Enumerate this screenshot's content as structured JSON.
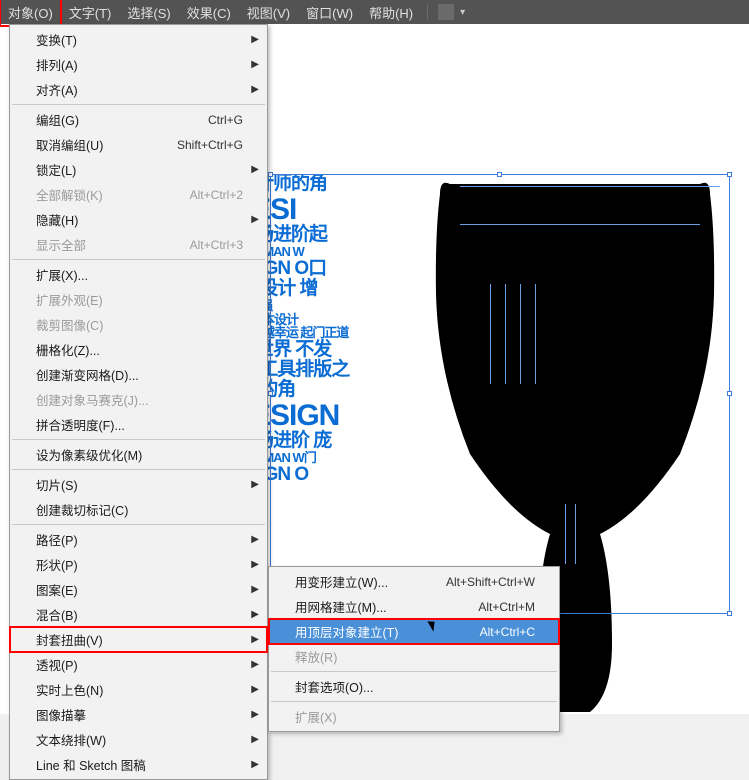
{
  "menubar": {
    "items": [
      {
        "label": "对象(O)",
        "active": true
      },
      {
        "label": "文字(T)"
      },
      {
        "label": "选择(S)"
      },
      {
        "label": "效果(C)"
      },
      {
        "label": "视图(V)"
      },
      {
        "label": "窗口(W)"
      },
      {
        "label": "帮助(H)"
      }
    ]
  },
  "dropdown": [
    {
      "type": "item",
      "label": "变换(T)",
      "submenu": true
    },
    {
      "type": "item",
      "label": "排列(A)",
      "submenu": true
    },
    {
      "type": "item",
      "label": "对齐(A)",
      "submenu": true
    },
    {
      "type": "sep"
    },
    {
      "type": "item",
      "label": "编组(G)",
      "shortcut": "Ctrl+G"
    },
    {
      "type": "item",
      "label": "取消编组(U)",
      "shortcut": "Shift+Ctrl+G"
    },
    {
      "type": "item",
      "label": "锁定(L)",
      "submenu": true
    },
    {
      "type": "item",
      "label": "全部解锁(K)",
      "shortcut": "Alt+Ctrl+2",
      "disabled": true
    },
    {
      "type": "item",
      "label": "隐藏(H)",
      "submenu": true
    },
    {
      "type": "item",
      "label": "显示全部",
      "shortcut": "Alt+Ctrl+3",
      "disabled": true
    },
    {
      "type": "sep"
    },
    {
      "type": "item",
      "label": "扩展(X)..."
    },
    {
      "type": "item",
      "label": "扩展外观(E)",
      "disabled": true
    },
    {
      "type": "item",
      "label": "裁剪图像(C)",
      "disabled": true
    },
    {
      "type": "item",
      "label": "栅格化(Z)..."
    },
    {
      "type": "item",
      "label": "创建渐变网格(D)..."
    },
    {
      "type": "item",
      "label": "创建对象马赛克(J)...",
      "disabled": true
    },
    {
      "type": "item",
      "label": "拼合透明度(F)..."
    },
    {
      "type": "sep"
    },
    {
      "type": "item",
      "label": "设为像素级优化(M)"
    },
    {
      "type": "sep"
    },
    {
      "type": "item",
      "label": "切片(S)",
      "submenu": true
    },
    {
      "type": "item",
      "label": "创建裁切标记(C)"
    },
    {
      "type": "sep"
    },
    {
      "type": "item",
      "label": "路径(P)",
      "submenu": true
    },
    {
      "type": "item",
      "label": "形状(P)",
      "submenu": true
    },
    {
      "type": "item",
      "label": "图案(E)",
      "submenu": true
    },
    {
      "type": "item",
      "label": "混合(B)",
      "submenu": true
    },
    {
      "type": "item",
      "label": "封套扭曲(V)",
      "submenu": true,
      "highlighted": true
    },
    {
      "type": "item",
      "label": "透视(P)",
      "submenu": true
    },
    {
      "type": "item",
      "label": "实时上色(N)",
      "submenu": true
    },
    {
      "type": "item",
      "label": "图像描摹",
      "submenu": true
    },
    {
      "type": "item",
      "label": "文本绕排(W)",
      "submenu": true
    },
    {
      "type": "item",
      "label": "Line 和 Sketch 图稿",
      "submenu": true
    },
    {
      "type": "cutoff"
    }
  ],
  "submenu": [
    {
      "type": "item",
      "label": "用变形建立(W)...",
      "shortcut": "Alt+Shift+Ctrl+W"
    },
    {
      "type": "item",
      "label": "用网格建立(M)...",
      "shortcut": "Alt+Ctrl+M"
    },
    {
      "type": "item",
      "label": "用顶层对象建立(T)",
      "shortcut": "Alt+Ctrl+C",
      "highlighted": true
    },
    {
      "type": "item",
      "label": "释放(R)",
      "disabled": true
    },
    {
      "type": "sep"
    },
    {
      "type": "item",
      "label": "封套选项(O)..."
    },
    {
      "type": "sep"
    },
    {
      "type": "item",
      "label": "扩展(X)",
      "disabled": true
    },
    {
      "type": "cutoff"
    }
  ],
  "canvas_text": {
    "rows": [
      {
        "cls": "row-med",
        "text": "运摄版以设计师的角"
      },
      {
        "cls": "row-big",
        "text": "MANDESI"
      },
      {
        "cls": "row-med",
        "text": "入职场文职场进阶起"
      },
      {
        "cls": "row-sm",
        "text": "版文特效摄版 ARTMAN W"
      },
      {
        "cls": "row-med",
        "text": "越幸运 DESIGN O口"
      },
      {
        "cls": "row-med",
        "text": "起门正道 以设计 增"
      },
      {
        "cls": "row-sm",
        "text": "RTMAN 师的角度 强"
      },
      {
        "cls": "row-sm",
        "text": "DESIGN 着世界 日本设计"
      },
      {
        "cls": "row-sm",
        "text": "UTORIALS 越努力越幸运 起门正道"
      },
      {
        "cls": "row-med",
        "text": "师的角度看世界 不发"
      },
      {
        "cls": "row-med",
        "text": "运 原创教程工具排版之"
      },
      {
        "cls": "row-med",
        "text": "起 以设计师的角"
      },
      {
        "cls": "row-big",
        "text": "MANDESIGN"
      },
      {
        "cls": "row-med",
        "text": "入职场文职场进阶 庞"
      },
      {
        "cls": "row-sm",
        "text": "版文特效摄版 ARTMAN W门"
      },
      {
        "cls": "row-med",
        "text": "越幸运 DESIGN O"
      }
    ]
  }
}
